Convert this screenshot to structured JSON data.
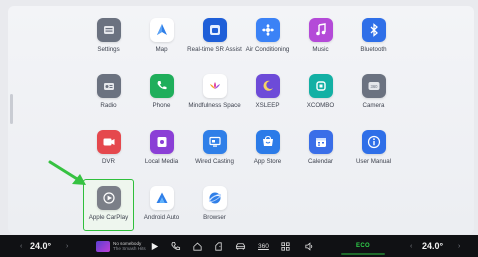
{
  "apps": [
    {
      "name": "settings",
      "label": "Settings",
      "icon": "settings-icon",
      "bg": "#6b7280"
    },
    {
      "name": "map",
      "label": "Map",
      "icon": "map-icon",
      "bg": "#ffffff"
    },
    {
      "name": "realtime-sr-assist",
      "label": "Real-time SR Assist",
      "icon": "sr-assist-icon",
      "bg": "#1f5fd8"
    },
    {
      "name": "air-conditioning",
      "label": "Air Conditioning",
      "icon": "fan-icon",
      "bg": "#3b82f6"
    },
    {
      "name": "music",
      "label": "Music",
      "icon": "music-note-icon",
      "bg": "#b44ad8"
    },
    {
      "name": "bluetooth",
      "label": "Bluetooth",
      "icon": "bluetooth-icon",
      "bg": "#2f6fe8"
    },
    {
      "name": "radio",
      "label": "Radio",
      "icon": "radio-icon",
      "bg": "#6b7280"
    },
    {
      "name": "phone",
      "label": "Phone",
      "icon": "phone-icon",
      "bg": "#1fae5b"
    },
    {
      "name": "mindfulness-space",
      "label": "Mindfulness Space",
      "icon": "lotus-icon",
      "bg": "#ffffff"
    },
    {
      "name": "xsleep",
      "label": "XSLEEP",
      "icon": "moon-icon",
      "bg": "#6d4bd8"
    },
    {
      "name": "xcombo",
      "label": "XCOMBO",
      "icon": "combo-icon",
      "bg": "#13b0a4"
    },
    {
      "name": "camera",
      "label": "Camera",
      "icon": "camera-360-icon",
      "bg": "#6b7280"
    },
    {
      "name": "dvr",
      "label": "DVR",
      "icon": "dvr-icon",
      "bg": "#e5484d"
    },
    {
      "name": "local-media",
      "label": "Local Media",
      "icon": "local-media-icon",
      "bg": "#8b3fd6"
    },
    {
      "name": "wired-casting",
      "label": "Wired Casting",
      "icon": "casting-icon",
      "bg": "#2f7fe8"
    },
    {
      "name": "app-store",
      "label": "App Store",
      "icon": "store-icon",
      "bg": "#2b7be8"
    },
    {
      "name": "calendar",
      "label": "Calendar",
      "icon": "calendar-icon",
      "bg": "#3a6ee8"
    },
    {
      "name": "user-manual",
      "label": "User Manual",
      "icon": "info-icon",
      "bg": "#2f6fe8"
    },
    {
      "name": "apple-carplay",
      "label": "Apple CarPlay",
      "icon": "carplay-icon",
      "bg": "#7b7f88",
      "selected": true
    },
    {
      "name": "android-auto",
      "label": "Android Auto",
      "icon": "android-auto-icon",
      "bg": "#ffffff"
    },
    {
      "name": "browser",
      "label": "Browser",
      "icon": "browser-icon",
      "bg": "#ffffff"
    }
  ],
  "dock": {
    "temp_left": "24.0°",
    "temp_right": "24.0°",
    "media_title": "No somebody",
    "media_sub": "The Smash Hits",
    "eco_label": "ECO",
    "camera_label": "360"
  }
}
